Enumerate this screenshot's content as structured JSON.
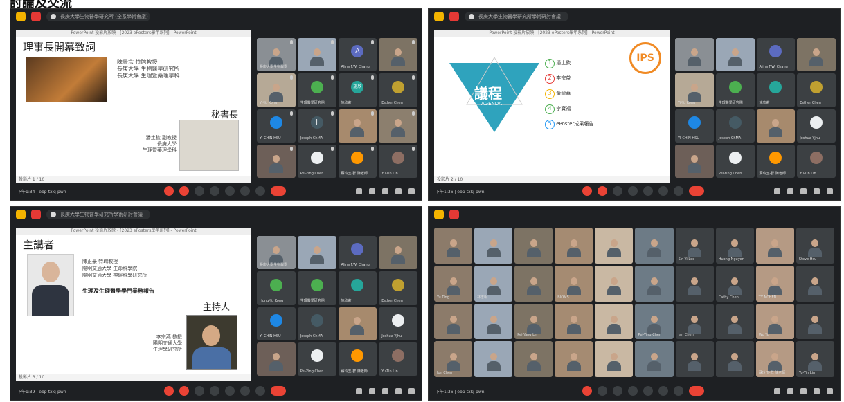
{
  "caption": "討論及交流",
  "panels": [
    {
      "meeting_title": "長庚大學生物醫學研究所 (全系學術會議)",
      "time": "下午1:34 | ebp-txkj-pwn",
      "slide_header": "PowerPoint 投影片放映 - [2023 ePosters學年系列] - PowerPoint",
      "slide_footer": "投影片 1 / 10",
      "slide_title": "理事長開幕致詞",
      "speaker_lines": [
        "陳景宗 特聘教授",
        "長庚大學 生物醫學研究所",
        "長庚大學 生理暨藥理學科"
      ],
      "role": "秘書長",
      "host_lines": [
        "潘土欽 副教授",
        "長庚大學",
        "生理暨藥理學科"
      ],
      "tiles": [
        "長庚大學生物醫學",
        "",
        "Alina F.W. Chang",
        "",
        "Yi-Yu Kong",
        "生理醫學研究團",
        "施欣莉",
        "Esther Chen",
        "Yi-CHIN HSU",
        "Joseph ChMA",
        "",
        "",
        "",
        "Pei-Ying Chen",
        "蘇玲玉-群 陳老師",
        "Yu-Tin Lin"
      ],
      "avatar_letters": [
        "A",
        "施欣",
        "j"
      ]
    },
    {
      "meeting_title": "長庚大學生物醫學研究所學術研討會議",
      "time": "下午1:36 | ebp-txkj-pwn",
      "slide_header": "PowerPoint 投影片放映 - [2023 ePosters學年系列] - PowerPoint",
      "slide_footer": "投影片 2 / 10",
      "agenda_title": "議程",
      "agenda_sub": "AGENDA",
      "agenda_items": [
        "潘土欽",
        "李宗益",
        "黃龍華",
        "李寶福",
        "ePoster成果報告"
      ],
      "logo_text": "IPS",
      "tiles": [
        "",
        "",
        "Alina F.W. Chang",
        "",
        "Yi-Yu Kong",
        "生理醫學研究團",
        "施欣莉",
        "Esther Chen",
        "YI-CHIN HSU",
        "Joseph ChMA",
        "",
        "Joshua Yjhu",
        "",
        "Pei-Ying Chen",
        "蘇玲玉-群 陳老師",
        "Yu-Tin Lin"
      ]
    },
    {
      "meeting_title": "長庚大學生物醫學研究所學術研討會議",
      "time": "下午1:39 | ebp-txkj-pwn",
      "slide_header": "PowerPoint 投影片放映 - [2023 ePosters學年系列] - PowerPoint",
      "slide_footer": "投影片 3 / 10",
      "slide_title": "主講者",
      "speaker_lines": [
        "陳正豪 特聘教授",
        "陽明交通大學 生命科學院",
        "陽明交通大學 神經科學研究所"
      ],
      "talk": "生理及生理醫學學門業務報告",
      "role": "主持人",
      "host_lines": [
        "李宗燕 教授",
        "陽明交通大學",
        "生理學研究所"
      ],
      "tiles": [
        "長庚大學生物醫學",
        "",
        "Alina F.W. Chang",
        "",
        "Hung-Yu Kong",
        "生理醫學研究團",
        "施欣莉",
        "Esther Chen",
        "Yi-CHIN HSU",
        "Joseph ChMA",
        "",
        "Joshua Yjhu",
        "",
        "Pei-Ying Chen",
        "蘇玲玉-群 陳老師",
        "Yu-Tin Lin"
      ]
    },
    {
      "time": "下午1:36 | ebp-txkj-pwn",
      "tiles": [
        "",
        "",
        "",
        "",
        "",
        "",
        "Sin-Yi Lee",
        "Huong Nguyen",
        "",
        "Steve Hsu",
        "Yu Ting",
        "林志明",
        "",
        "BIOMS",
        "",
        "",
        "",
        "Cathy Chen",
        "TY NCHEN",
        "",
        "",
        "",
        "Pei-Yang Lin",
        "",
        "",
        "Pei-Ying Chen",
        "Jan Chen",
        "",
        "Wu Yu",
        "",
        "Jon Chen",
        "",
        "",
        "",
        "",
        "",
        "",
        "",
        "蘇玲玉-群 陳老師",
        "Yu-Tin Lin"
      ]
    }
  ]
}
